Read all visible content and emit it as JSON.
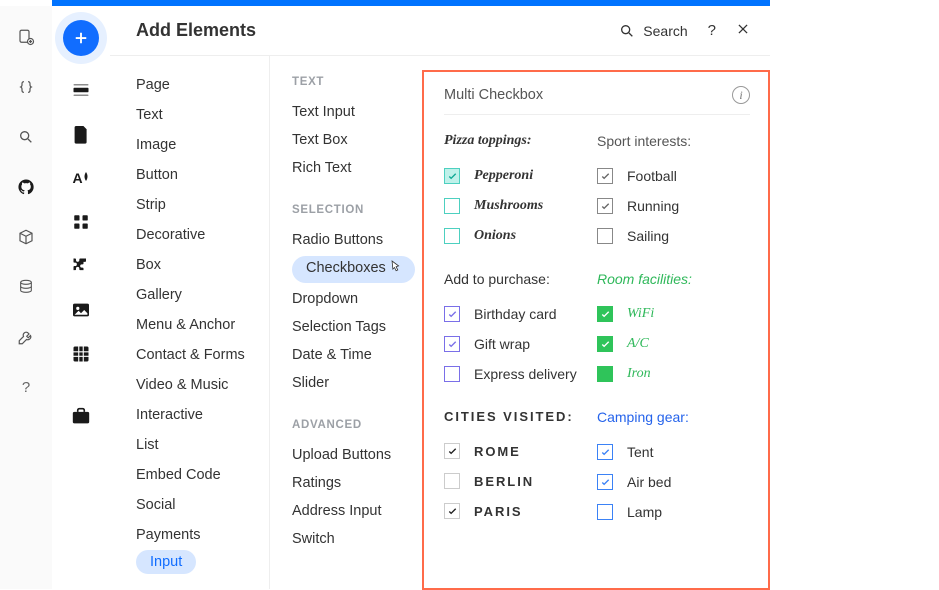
{
  "panel": {
    "title": "Add Elements",
    "search_label": "Search"
  },
  "col1": {
    "items": [
      "Page",
      "Text",
      "Image",
      "Button",
      "Strip",
      "Decorative",
      "Box",
      "Gallery",
      "Menu & Anchor",
      "Contact & Forms",
      "Video & Music",
      "Interactive",
      "List",
      "Embed Code",
      "Social",
      "Payments",
      "Input"
    ]
  },
  "col2": {
    "sections": {
      "text": {
        "heading": "TEXT",
        "items": [
          "Text Input",
          "Text Box",
          "Rich Text"
        ]
      },
      "selection": {
        "heading": "SELECTION",
        "items": [
          "Radio Buttons",
          "Checkboxes",
          "Dropdown",
          "Selection Tags",
          "Date & Time",
          "Slider"
        ]
      },
      "advanced": {
        "heading": "ADVANCED",
        "items": [
          "Upload Buttons",
          "Ratings",
          "Address Input",
          "Switch"
        ]
      }
    },
    "highlighted": "Checkboxes"
  },
  "preview": {
    "title": "Multi Checkbox",
    "groups": {
      "pizza": {
        "title": "Pizza toppings:",
        "opts": [
          {
            "label": "Pepperoni",
            "checked": true
          },
          {
            "label": "Mushrooms",
            "checked": false
          },
          {
            "label": "Onions",
            "checked": false
          }
        ]
      },
      "sport": {
        "title": "Sport interests:",
        "opts": [
          {
            "label": "Football",
            "checked": true
          },
          {
            "label": "Running",
            "checked": true
          },
          {
            "label": "Sailing",
            "checked": false
          }
        ]
      },
      "purchase": {
        "title": "Add to purchase:",
        "opts": [
          {
            "label": "Birthday card",
            "checked": true
          },
          {
            "label": "Gift wrap",
            "checked": true
          },
          {
            "label": "Express delivery",
            "checked": false
          }
        ]
      },
      "room": {
        "title": "Room facilities:",
        "opts": [
          {
            "label": "WiFi",
            "checked": true
          },
          {
            "label": "A/C",
            "checked": true
          },
          {
            "label": "Iron",
            "checked": false
          }
        ]
      },
      "cities": {
        "title": "Cities visited:",
        "opts": [
          {
            "label": "Rome",
            "checked": true
          },
          {
            "label": "Berlin",
            "checked": false
          },
          {
            "label": "Paris",
            "checked": true
          }
        ]
      },
      "camping": {
        "title": "Camping gear:",
        "opts": [
          {
            "label": "Tent",
            "checked": true
          },
          {
            "label": "Air bed",
            "checked": true
          },
          {
            "label": "Lamp",
            "checked": false
          }
        ]
      }
    }
  }
}
